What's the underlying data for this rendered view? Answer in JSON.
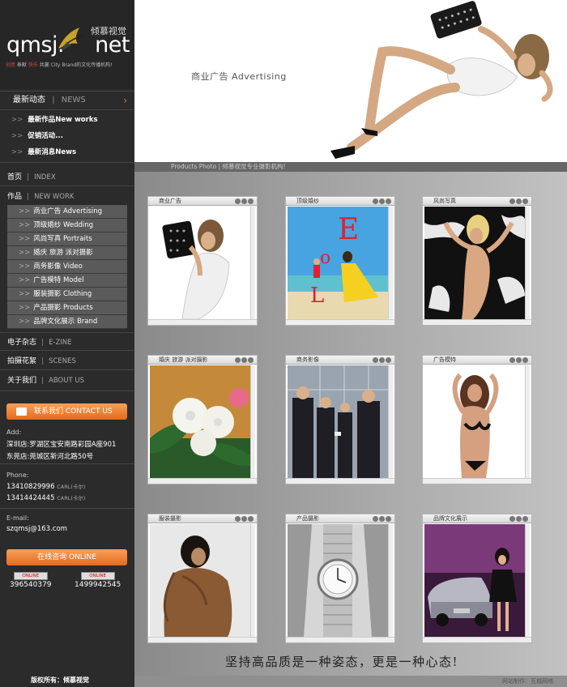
{
  "logo": {
    "text": "qmsj.",
    "text2": "net",
    "cn": "倾慕视觉",
    "slogan_a": "创意",
    "slogan_b": " 奉献 ",
    "slogan_c": "快乐",
    "slogan_d": " 共赢 City Brand的文化传播机构!"
  },
  "news": {
    "title_cn": "最新动态",
    "title_en": "NEWS",
    "arrow": "›",
    "items": [
      "最新作品New works",
      "促销活动...",
      "最新消息News"
    ]
  },
  "nav": {
    "home_cn": "首页",
    "home_en": "INDEX",
    "work_cn": "作品",
    "work_en": "NEW WORK",
    "ezine_cn": "电子杂志",
    "ezine_en": "E-ZINE",
    "scenes_cn": "拍摄花絮",
    "scenes_en": "SCENES",
    "about_cn": "关于我们",
    "about_en": "ABOUT US"
  },
  "submenu": [
    "商业广告 Advertising",
    "顶级婚纱 Wedding",
    "风尚写真 Portraits",
    "婚庆 旅游 派对摄影",
    "商务影像 Video",
    "广告模特 Model",
    "服装摄影 Clothing",
    "产品摄影 Products",
    "品牌文化展示 Brand"
  ],
  "contact": {
    "button": "联系我们 CONTACT US",
    "addr_label": "Add:",
    "addr1": "深圳店:罗湖区宝安南路彩园A座901",
    "addr2": "东莞店:莞城区新河北路50号",
    "phone_label": "Phone:",
    "phone1": "13410829996",
    "phone1_name": "CARL(卡尔)",
    "phone2": "13414424445",
    "phone2_name": "CARL(卡尔)",
    "email_label": "E-mail:",
    "email": "szqmsj@163.com"
  },
  "online": {
    "button": "在线咨询 ONLINE",
    "badge": "ONLINE",
    "qq1": "396540379",
    "qq2": "1499942545"
  },
  "header": {
    "title": "商业广告 Advertising",
    "strip": "Products Photo | 倾慕视觉专业摄影机构!"
  },
  "gallery": [
    {
      "title": "商业广告"
    },
    {
      "title": "顶级婚纱"
    },
    {
      "title": "风尚写真"
    },
    {
      "title": "婚庆 旅游 派对摄影"
    },
    {
      "title": "商务影像"
    },
    {
      "title": "广告模特"
    },
    {
      "title": "服装摄影"
    },
    {
      "title": "产品摄影"
    },
    {
      "title": "品牌文化展示"
    }
  ],
  "motto": "坚持高品质是一种姿态，更是一种心态!",
  "footer": {
    "copyright": "版权所有：倾慕视觉",
    "credit": "网站制作：",
    "credit2": "互城网络"
  }
}
